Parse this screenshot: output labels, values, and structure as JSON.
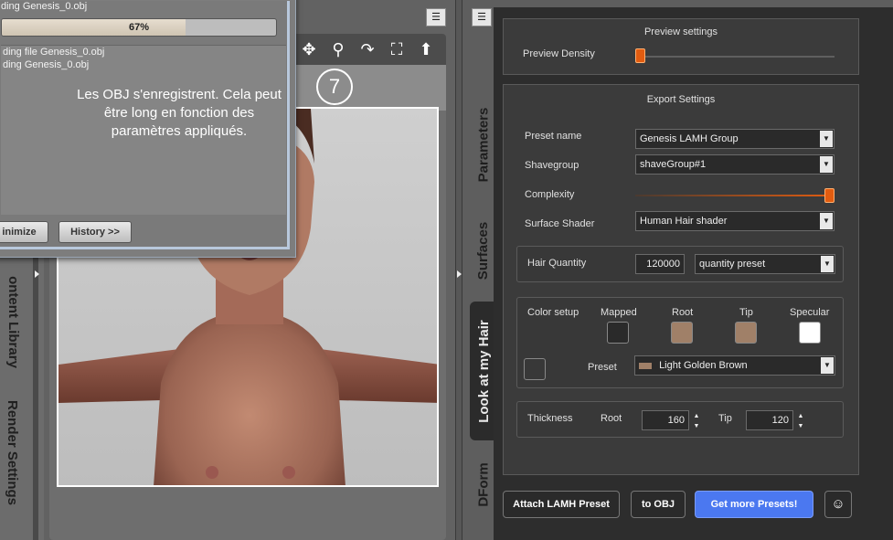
{
  "dialog": {
    "status_text": "ding Genesis_0.obj",
    "progress": {
      "value": 0.67,
      "label": "67%"
    },
    "log_lines": [
      "ding file Genesis_0.obj",
      "ding Genesis_0.obj"
    ],
    "note": "Les OBJ s'enregistrent. Cela peut être long en fonction des paramètres appliqués.",
    "minimize_label": "inimize",
    "history_label": "History >>"
  },
  "left_tabs": [
    "ontent Library",
    "Render Settings"
  ],
  "viewport": {
    "step_number": "7",
    "tools": [
      "move-icon",
      "zoom-icon",
      "orbit-icon",
      "frame-icon",
      "home-icon"
    ]
  },
  "side_tabs": [
    "Parameters",
    "Surfaces",
    "Look at my Hair",
    "DForm"
  ],
  "preview": {
    "title": "Preview settings",
    "density_label": "Preview Density",
    "density_value": 0
  },
  "export": {
    "title": "Export Settings",
    "preset_name_label": "Preset name",
    "preset_name_value": "Genesis LAMH Group",
    "shavegroup_label": "Shavegroup",
    "shavegroup_value": "shaveGroup#1",
    "complexity_label": "Complexity",
    "complexity_value": 1,
    "surface_shader_label": "Surface Shader",
    "surface_shader_value": "Human Hair shader",
    "hair_quantity_label": "Hair Quantity",
    "hair_quantity_value": "120000",
    "quantity_preset_value": "quantity preset",
    "color_setup_label": "Color setup",
    "mapped_label": "Mapped",
    "root_label": "Root",
    "tip_label": "Tip",
    "specular_label": "Specular",
    "preset_label": "Preset",
    "preset_value": "Light Golden Brown",
    "thickness_label": "Thickness",
    "thickness_root_label": "Root",
    "thickness_root_value": "160",
    "thickness_tip_label": "Tip",
    "thickness_tip_value": "120"
  },
  "colors": {
    "mapped": "#2a2a2a",
    "root": "#a08068",
    "tip": "#a08068",
    "specular": "#ffffff",
    "preset_chip": "#a08068",
    "accent_orange": "#e25c10",
    "button_blue": "#4b78f0"
  },
  "footer": {
    "attach_label": "Attach LAMH Preset",
    "to_obj_label": "to OBJ",
    "more_presets_label": "Get more Presets!"
  }
}
